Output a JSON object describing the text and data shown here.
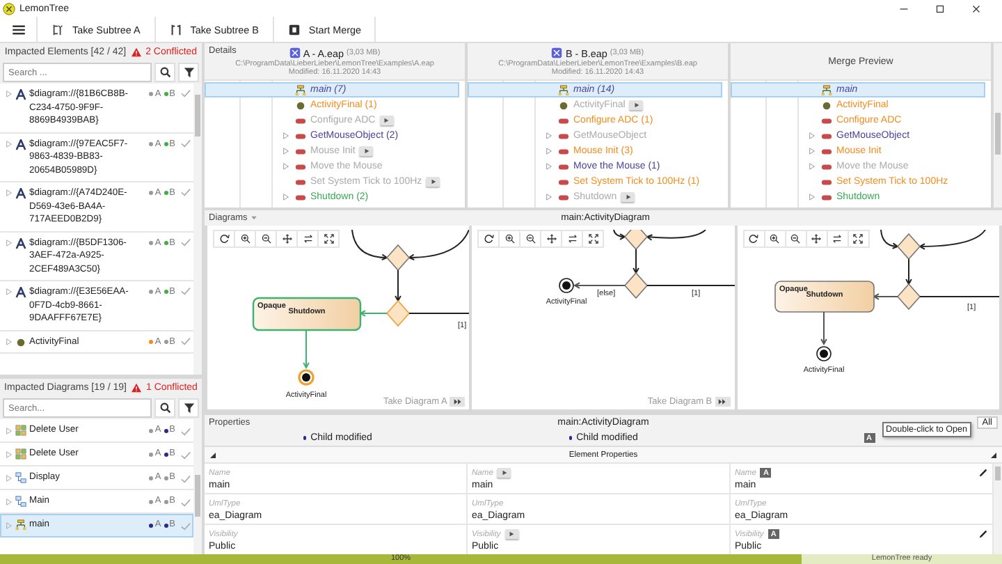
{
  "window": {
    "title": "LemonTree"
  },
  "toolbar": [
    {
      "kind": "menu"
    },
    {
      "kind": "subtree_a",
      "label": "Take Subtree A"
    },
    {
      "kind": "subtree_b",
      "label": "Take Subtree B"
    },
    {
      "kind": "merge",
      "label": "Start Merge"
    }
  ],
  "impacted_elements": {
    "title": "Impacted Elements [42 / 42]",
    "conflicts": "2 Conflicted",
    "search": {
      "placeholder": "Search ..."
    },
    "items": [
      {
        "kind": "diagram",
        "name": "$diagram://{81B6CB8B-C234-4750-9F9F-8869B4939BAB}",
        "sides": [
          {
            "label": "A",
            "color": "#999999"
          },
          {
            "label": "B",
            "color": "#3cb043"
          }
        ]
      },
      {
        "kind": "diagram",
        "name": "$diagram://{97EAC5F7-9863-4839-BB83-20654B05989D}",
        "sides": [
          {
            "label": "A",
            "color": "#999999"
          },
          {
            "label": "B",
            "color": "#3cb043"
          }
        ]
      },
      {
        "kind": "diagram",
        "name": "$diagram://{A74D240E-D569-43e6-BA4A-717AEED0B2D9}",
        "sides": [
          {
            "label": "A",
            "color": "#999999"
          },
          {
            "label": "B",
            "color": "#3cb043"
          }
        ]
      },
      {
        "kind": "diagram",
        "name": "$diagram://{B5DF1306-3AEF-472a-A925-2CEF489A3C50}",
        "sides": [
          {
            "label": "A",
            "color": "#999999"
          },
          {
            "label": "B",
            "color": "#3cb043"
          }
        ]
      },
      {
        "kind": "diagram",
        "name": "$diagram://{E3E56EAA-0F7D-4cb9-8661-9DAAFFF67E7E}",
        "sides": [
          {
            "label": "A",
            "color": "#999999"
          },
          {
            "label": "B",
            "color": "#3cb043"
          }
        ]
      },
      {
        "kind": "final",
        "name": "ActivityFinal",
        "sides": [
          {
            "label": "A",
            "color": "#f28c1e"
          },
          {
            "label": "B",
            "color": "#999999"
          }
        ]
      }
    ]
  },
  "impacted_diagrams": {
    "title": "Impacted Diagrams [19 / 19]",
    "conflicts": "1 Conflicted",
    "search": {
      "placeholder": "Search..."
    },
    "items": [
      {
        "kind": "usecase",
        "name": "Delete User",
        "selected": false,
        "sides": [
          {
            "label": "A",
            "color": "#999999"
          },
          {
            "label": "B",
            "color": "#2a2a8a"
          }
        ]
      },
      {
        "kind": "usecase",
        "name": "Delete User",
        "selected": false,
        "sides": [
          {
            "label": "A",
            "color": "#999999"
          },
          {
            "label": "B",
            "color": "#2a2a8a"
          }
        ]
      },
      {
        "kind": "component",
        "name": "Display",
        "selected": false,
        "sides": [
          {
            "label": "A",
            "color": "#999999"
          },
          {
            "label": "B",
            "color": "#999999"
          }
        ]
      },
      {
        "kind": "component",
        "name": "Main",
        "selected": false,
        "sides": [
          {
            "label": "A",
            "color": "#999999"
          },
          {
            "label": "B",
            "color": "#999999"
          }
        ]
      },
      {
        "kind": "activity",
        "name": "main",
        "selected": true,
        "sides": [
          {
            "label": "A",
            "color": "#2a2a8a"
          },
          {
            "label": "B",
            "color": "#2a2a8a"
          }
        ]
      }
    ]
  },
  "details": {
    "label": "Details",
    "columns": [
      {
        "kind": "model",
        "title": "A - A.eap",
        "size": "(3,03 MB)",
        "path": "C:\\ProgramData\\LieberLieber\\LemonTree\\Examples\\A.eap",
        "modified": "Modified: 16.11.2020 14:43",
        "rows": [
          {
            "kind": "diagram",
            "name": "main (7)",
            "color": "#4b3f9e",
            "selected": true,
            "expandable": false,
            "play": false
          },
          {
            "kind": "final",
            "name": "ActivityFinal (1)",
            "color": "#f28c1e",
            "selected": false,
            "expandable": false,
            "play": false
          },
          {
            "kind": "action",
            "name": "Configure ADC",
            "color": "#aaaaaa",
            "selected": false,
            "expandable": false,
            "play": true
          },
          {
            "kind": "action",
            "name": "GetMouseObject (2)",
            "color": "#4b3f9e",
            "selected": false,
            "expandable": true,
            "play": false
          },
          {
            "kind": "action",
            "name": "Mouse Init",
            "color": "#aaaaaa",
            "selected": false,
            "expandable": true,
            "play": true
          },
          {
            "kind": "action",
            "name": "Move the Mouse",
            "color": "#aaaaaa",
            "selected": false,
            "expandable": true,
            "play": false
          },
          {
            "kind": "action",
            "name": "Set System Tick to 100Hz",
            "color": "#aaaaaa",
            "selected": false,
            "expandable": false,
            "play": true
          },
          {
            "kind": "action",
            "name": "Shutdown (2)",
            "color": "#3aa655",
            "selected": false,
            "expandable": true,
            "play": false
          }
        ]
      },
      {
        "kind": "model",
        "title": "B - B.eap",
        "size": "(3,03 MB)",
        "path": "C:\\ProgramData\\LieberLieber\\LemonTree\\Examples\\B.eap",
        "modified": "Modified: 16.11.2020 14:43",
        "rows": [
          {
            "kind": "diagram",
            "name": "main (14)",
            "color": "#4b3f9e",
            "selected": true,
            "expandable": false,
            "play": false
          },
          {
            "kind": "final",
            "name": "ActivityFinal",
            "color": "#aaaaaa",
            "selected": false,
            "expandable": false,
            "play": true
          },
          {
            "kind": "action",
            "name": "Configure ADC (1)",
            "color": "#f28c1e",
            "selected": false,
            "expandable": false,
            "play": false
          },
          {
            "kind": "action",
            "name": "GetMouseObject",
            "color": "#aaaaaa",
            "selected": false,
            "expandable": true,
            "play": false
          },
          {
            "kind": "action",
            "name": "Mouse Init (3)",
            "color": "#f28c1e",
            "selected": false,
            "expandable": true,
            "play": false
          },
          {
            "kind": "action",
            "name": "Move the Mouse (1)",
            "color": "#4b3f9e",
            "selected": false,
            "expandable": true,
            "play": false
          },
          {
            "kind": "action",
            "name": "Set System Tick to 100Hz (1)",
            "color": "#f28c1e",
            "selected": false,
            "expandable": false,
            "play": false
          },
          {
            "kind": "action",
            "name": "Shutdown",
            "color": "#aaaaaa",
            "selected": false,
            "expandable": true,
            "play": true
          }
        ]
      },
      {
        "kind": "preview",
        "title": "Merge Preview",
        "rows": [
          {
            "kind": "diagram",
            "name": "main",
            "color": "#4b3f9e",
            "selected": true,
            "expandable": false,
            "play": false
          },
          {
            "kind": "final",
            "name": "ActivityFinal",
            "color": "#f28c1e",
            "selected": false,
            "expandable": false,
            "play": false
          },
          {
            "kind": "action",
            "name": "Configure ADC",
            "color": "#f28c1e",
            "selected": false,
            "expandable": false,
            "play": false
          },
          {
            "kind": "action",
            "name": "GetMouseObject",
            "color": "#4b3f9e",
            "selected": false,
            "expandable": true,
            "play": false
          },
          {
            "kind": "action",
            "name": "Mouse Init",
            "color": "#f28c1e",
            "selected": false,
            "expandable": true,
            "play": false
          },
          {
            "kind": "action",
            "name": "Move the Mouse",
            "color": "#aaaaaa",
            "selected": false,
            "expandable": true,
            "play": false
          },
          {
            "kind": "action",
            "name": "Set System Tick to 100Hz",
            "color": "#f28c1e",
            "selected": false,
            "expandable": false,
            "play": false
          },
          {
            "kind": "action",
            "name": "Shutdown",
            "color": "#3aa655",
            "selected": false,
            "expandable": true,
            "play": false
          }
        ]
      }
    ]
  },
  "diagrams": {
    "label": "Diagrams",
    "title": "main:ActivityDiagram",
    "canvases": [
      {
        "kind": "conflict",
        "highlighted": true,
        "stereotype": "Opaque",
        "action": "Shutdown",
        "final": "ActivityFinal",
        "guard": "[1]",
        "footer": "Take Diagram A"
      },
      {
        "kind": "else",
        "highlighted": false,
        "final": "ActivityFinal",
        "guard": "[1]",
        "else_guard": "[else]",
        "footer": "Take Diagram B"
      },
      {
        "kind": "preview",
        "highlighted": false,
        "stereotype": "Opaque",
        "action": "Shutdown",
        "final": "ActivityFinal",
        "guard": "[1]"
      }
    ]
  },
  "properties": {
    "label": "Properties",
    "title": "main:ActivityDiagram",
    "tooltip": "Double-click to Open",
    "filter_button": "All",
    "states": [
      {
        "kind": "text",
        "label": "Child modified"
      },
      {
        "kind": "text",
        "label": "Child modified"
      },
      {
        "kind": "badge",
        "label": "A"
      }
    ],
    "section": "Element Properties",
    "rows": [
      {
        "cells": [
          {
            "kind": "plain",
            "label": "Name",
            "value": "main"
          },
          {
            "kind": "play",
            "label": "Name",
            "value": "main"
          },
          {
            "kind": "badge",
            "label": "Name",
            "value": "main",
            "badge": "A",
            "editable": true
          }
        ]
      },
      {
        "cells": [
          {
            "kind": "plain",
            "label": "UmlType",
            "value": "ea_Diagram"
          },
          {
            "kind": "plain",
            "label": "UmlType",
            "value": "ea_Diagram"
          },
          {
            "kind": "plain",
            "label": "UmlType",
            "value": "ea_Diagram"
          }
        ]
      },
      {
        "cells": [
          {
            "kind": "plain",
            "label": "Visibility",
            "value": "Public"
          },
          {
            "kind": "play",
            "label": "Visibility",
            "value": "Public"
          },
          {
            "kind": "badge",
            "label": "Visibility",
            "value": "Public",
            "badge": "A",
            "editable": true
          }
        ]
      }
    ]
  },
  "status_bar": {
    "progress": {
      "label": "100%",
      "level": 0.8
    },
    "message": "LemonTree ready"
  }
}
